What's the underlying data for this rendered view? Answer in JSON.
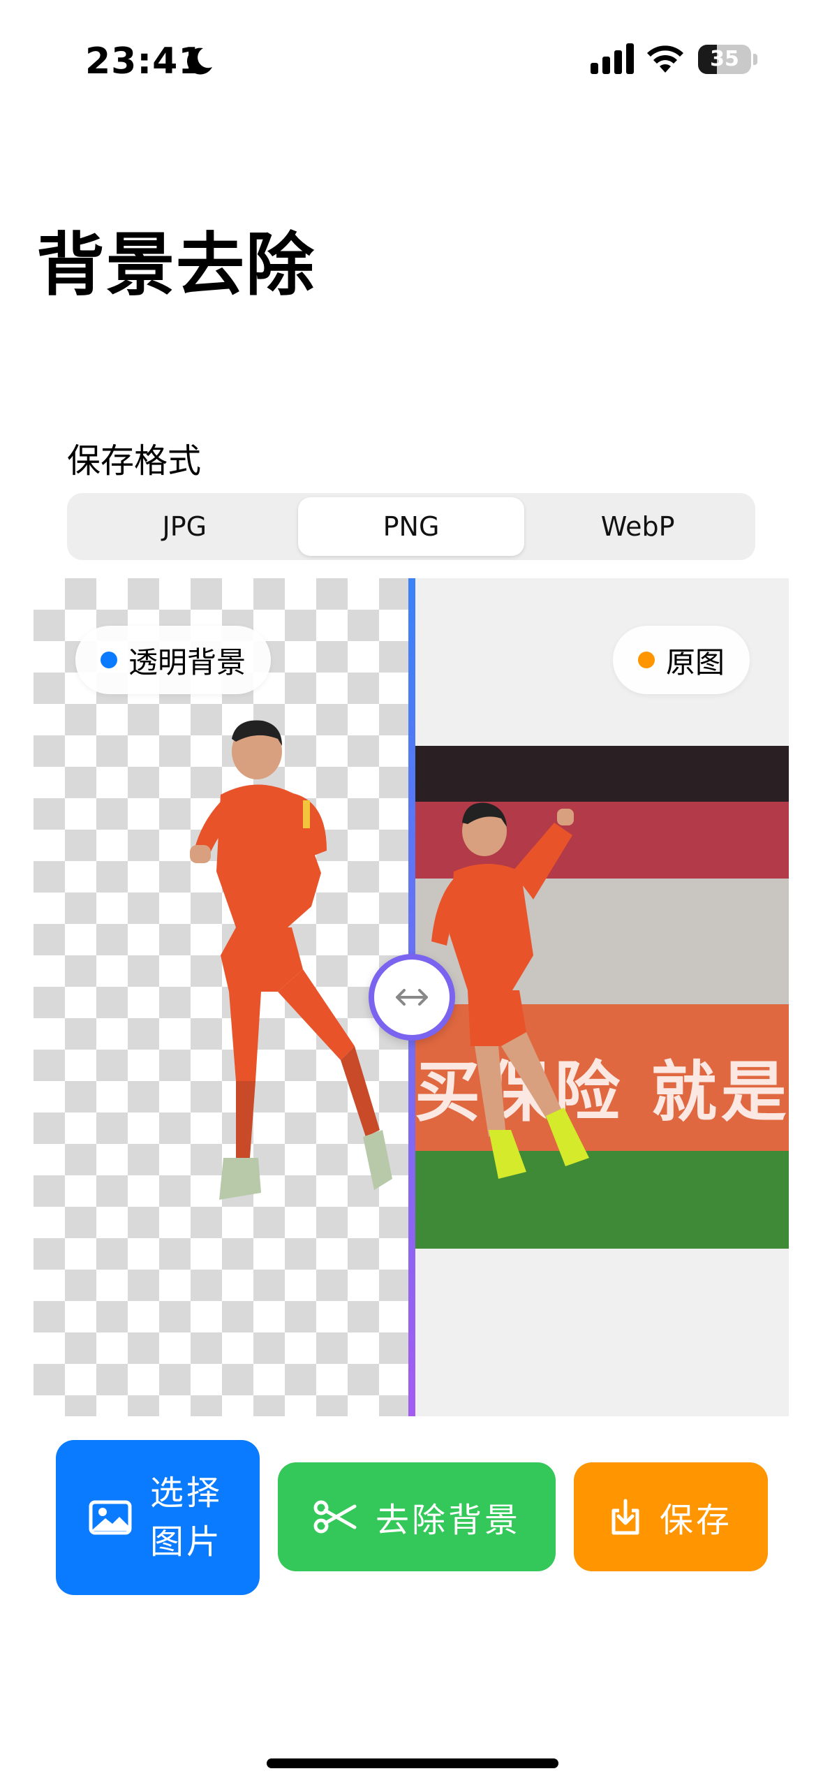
{
  "status_bar": {
    "time": "23:41",
    "battery_level": "35",
    "battery_fraction": 0.35,
    "icons": [
      "moon-icon",
      "signal-icon",
      "wifi-icon",
      "battery-icon"
    ]
  },
  "page": {
    "title": "背景去除"
  },
  "format": {
    "label": "保存格式",
    "options": [
      "JPG",
      "PNG",
      "WebP"
    ],
    "selected": "PNG"
  },
  "compare": {
    "left_label": "透明背景",
    "right_label": "原图",
    "left_dot_color": "#0a7bff",
    "right_dot_color": "#ff9500",
    "divider_colors": [
      "#3b82f6",
      "#a35cf0"
    ],
    "photo_banner_text": "买保险 就是买"
  },
  "actions": {
    "select": {
      "label": "选择图片",
      "color": "#0a7bff",
      "icon": "image-icon"
    },
    "remove": {
      "label": "去除背景",
      "color": "#34c759",
      "icon": "scissors-icon"
    },
    "save": {
      "label": "保存",
      "color": "#ff9500",
      "icon": "download-icon"
    }
  }
}
